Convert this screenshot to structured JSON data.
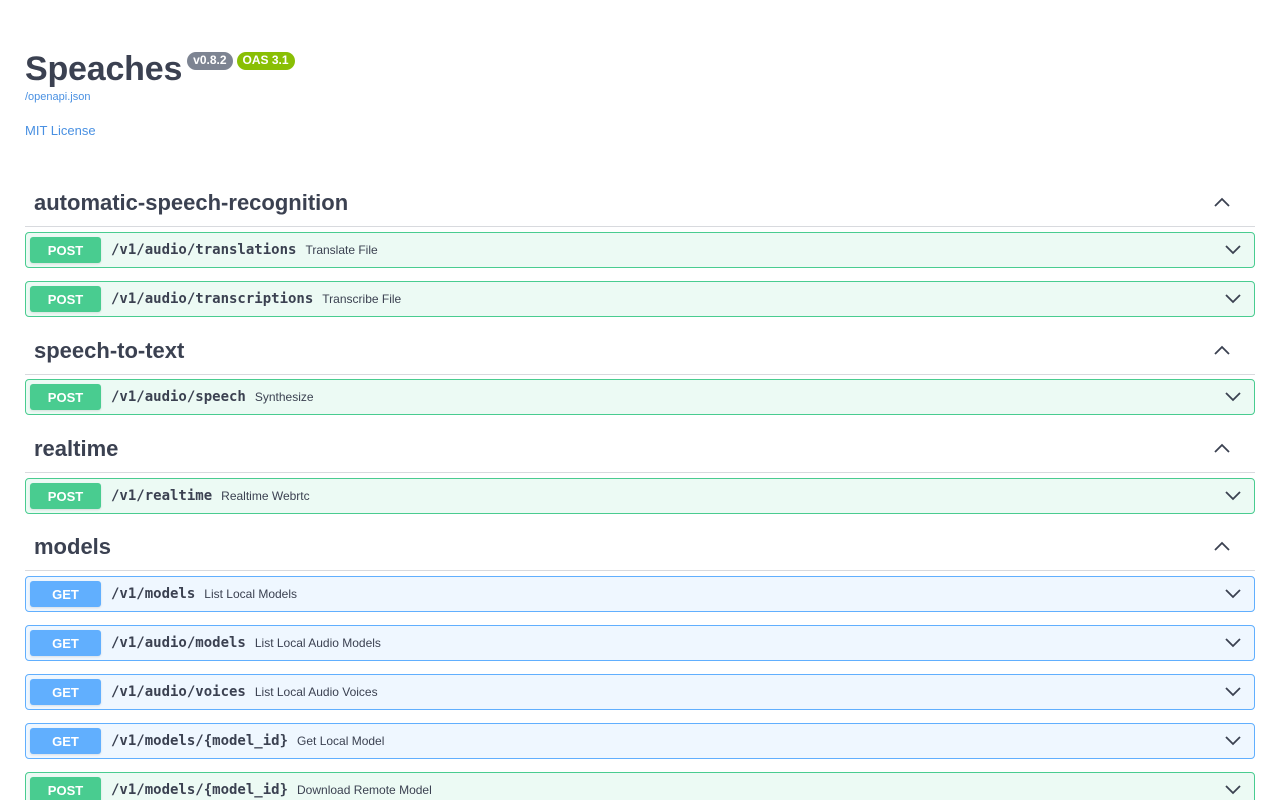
{
  "info": {
    "title": "Speaches",
    "version_badge": "v0.8.2",
    "oas_badge": "OAS 3.1",
    "spec_link": "/openapi.json",
    "license_link": "MIT License"
  },
  "tags": [
    {
      "name": "automatic-speech-recognition",
      "operations": [
        {
          "method": "POST",
          "path": "/v1/audio/translations",
          "summary": "Translate File"
        },
        {
          "method": "POST",
          "path": "/v1/audio/transcriptions",
          "summary": "Transcribe File"
        }
      ]
    },
    {
      "name": "speech-to-text",
      "operations": [
        {
          "method": "POST",
          "path": "/v1/audio/speech",
          "summary": "Synthesize"
        }
      ]
    },
    {
      "name": "realtime",
      "operations": [
        {
          "method": "POST",
          "path": "/v1/realtime",
          "summary": "Realtime Webrtc"
        }
      ]
    },
    {
      "name": "models",
      "operations": [
        {
          "method": "GET",
          "path": "/v1/models",
          "summary": "List Local Models"
        },
        {
          "method": "GET",
          "path": "/v1/audio/models",
          "summary": "List Local Audio Models"
        },
        {
          "method": "GET",
          "path": "/v1/audio/voices",
          "summary": "List Local Audio Voices"
        },
        {
          "method": "GET",
          "path": "/v1/models/{model_id}",
          "summary": "Get Local Model"
        },
        {
          "method": "POST",
          "path": "/v1/models/{model_id}",
          "summary": "Download Remote Model"
        }
      ]
    }
  ],
  "colors": {
    "post": "#49cc90",
    "get": "#61affe",
    "text": "#3b4151",
    "link": "#4990e2"
  },
  "icons": {
    "tag_toggle": "chevron-up-icon",
    "op_toggle": "chevron-down-icon"
  }
}
